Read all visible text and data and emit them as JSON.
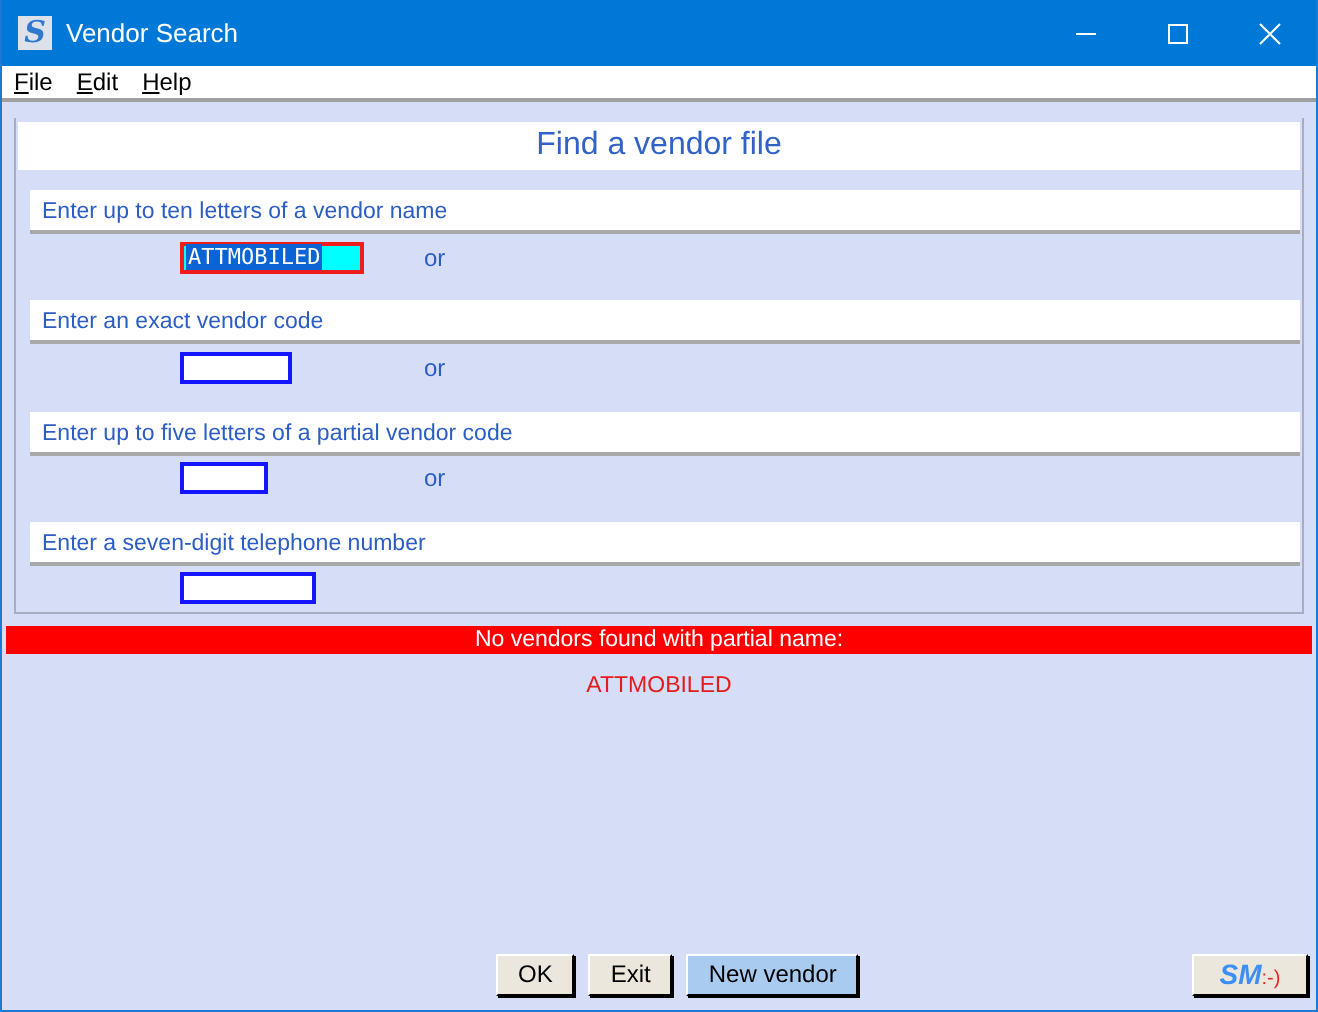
{
  "window": {
    "logo_letter": "S",
    "title": "Vendor Search"
  },
  "menu": [
    {
      "mnemonic": "F",
      "rest": "ile"
    },
    {
      "mnemonic": "E",
      "rest": "dit"
    },
    {
      "mnemonic": "H",
      "rest": "elp"
    }
  ],
  "panel": {
    "title": "Find a vendor file",
    "searches": [
      {
        "label": "Enter up to ten letters of a vendor name",
        "value": "ATTMOBILED",
        "focused": true,
        "kind": "name",
        "separator": "or"
      },
      {
        "label": "Enter an exact vendor code",
        "focused": false,
        "kind": "code",
        "separator": "or"
      },
      {
        "label": "Enter up to five letters of a partial vendor code",
        "focused": false,
        "kind": "partial",
        "separator": "or"
      },
      {
        "label": "Enter a seven-digit telephone number",
        "focused": false,
        "kind": "phone"
      }
    ]
  },
  "message": {
    "banner": "No vendors found with partial name:",
    "detail": "ATTMOBILED"
  },
  "buttons": [
    {
      "label": "OK",
      "highlighted": false
    },
    {
      "label": "Exit",
      "highlighted": false
    },
    {
      "label": "New vendor",
      "highlighted": true
    }
  ],
  "sm_button": {
    "letters": "SM",
    "smiley": ":-)"
  }
}
